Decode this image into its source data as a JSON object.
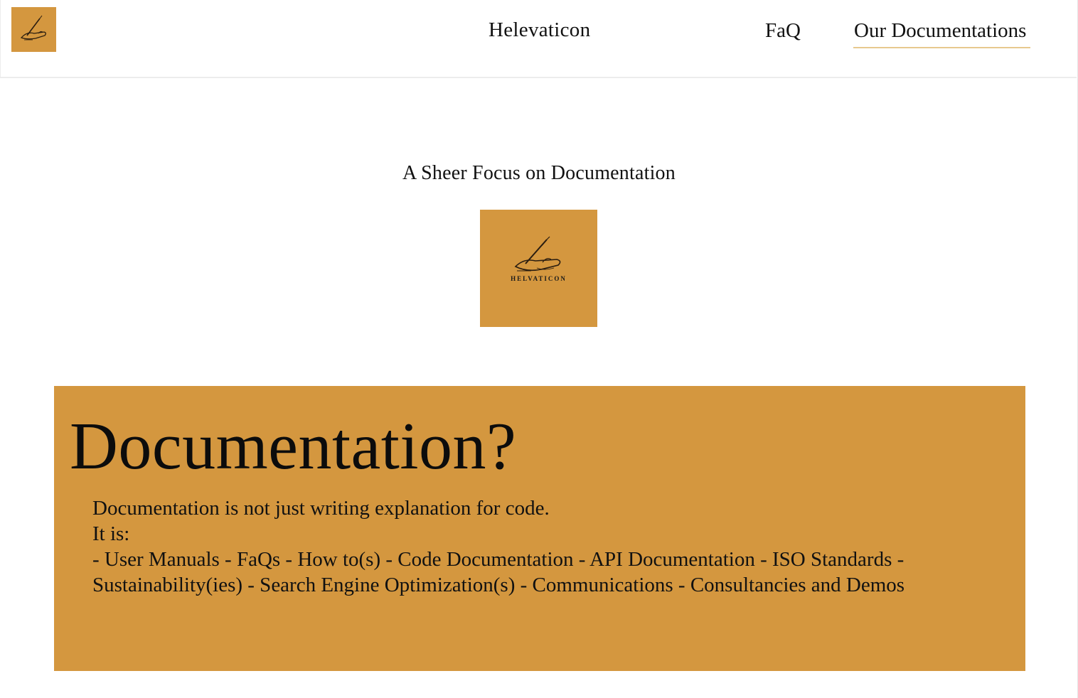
{
  "header": {
    "brand_name": "Helevaticon",
    "nav": {
      "faq_label": "FaQ",
      "docs_label": "Our Documentations"
    }
  },
  "logo": {
    "wordmark": "HELVATICON"
  },
  "hero": {
    "tagline": "A Sheer Focus on Documentation"
  },
  "panel": {
    "title": "Documentation?",
    "line1": "Documentation is not just writing explanation for code.",
    "line2": "It is:",
    "line3": "- User Manuals - FaQs - How to(s) - Code Documentation - API Documentation - ISO Standards - Sustainability(ies) - Search Engine Optimization(s) - Communications - Consultancies and Demos"
  },
  "colors": {
    "brand_gold": "#d4973f",
    "active_underline": "#e7c98f",
    "text": "#111111",
    "background": "#ffffff"
  }
}
